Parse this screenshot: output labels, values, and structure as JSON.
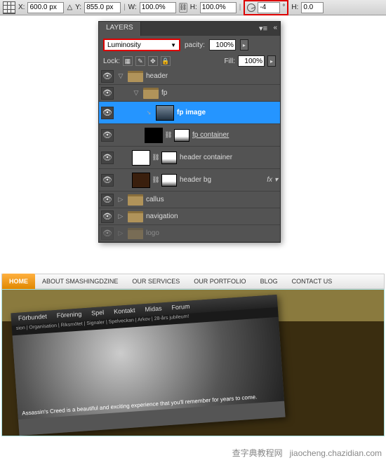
{
  "options": {
    "x_lbl": "X:",
    "x": "600.0 px",
    "y_lbl": "Y:",
    "y": "855.0 px",
    "delta_lbl": "△",
    "w_lbl": "W:",
    "w": "100.0%",
    "h_lbl": "H:",
    "h": "100.0%",
    "angle": "-4",
    "angle_unit": "°",
    "h2_lbl": "H:",
    "h2": "0.0"
  },
  "panel": {
    "tab": "LAYERS",
    "blend_mode": "Luminosity",
    "opacity_lbl": "pacity:",
    "opacity_val": "100%",
    "lock_lbl": "Lock:",
    "fill_lbl": "Fill:",
    "fill_val": "100%",
    "fx_lbl": "fx",
    "layers": [
      {
        "name": "header",
        "type": "group",
        "open": true,
        "indent": 0
      },
      {
        "name": "fp",
        "type": "group",
        "open": true,
        "indent": 1
      },
      {
        "name": "fp image",
        "type": "layer",
        "sel": true,
        "indent": 2,
        "thumb": "img"
      },
      {
        "name": "fp container",
        "type": "layer",
        "indent": 2,
        "thumb": "blk",
        "mask": true
      },
      {
        "name": "header container",
        "type": "layer",
        "indent": 1,
        "thumb": "wht",
        "mask": true
      },
      {
        "name": "header bg",
        "type": "layer",
        "indent": 1,
        "thumb": "brn",
        "mask": true,
        "fx": true
      },
      {
        "name": "callus",
        "type": "group",
        "open": false,
        "indent": 0
      },
      {
        "name": "navigation",
        "type": "group",
        "open": false,
        "indent": 0
      },
      {
        "name": "logo",
        "type": "group",
        "open": false,
        "indent": 0,
        "faded": true
      }
    ]
  },
  "mockup": {
    "nav": [
      "HOME",
      "ABOUT SMASHINGDZINE",
      "OUR SERVICES",
      "OUR PORTFOLIO",
      "BLOG",
      "CONTACT US"
    ],
    "warp_nav": [
      "Förbundet",
      "Förening",
      "Spel",
      "Kontakt",
      "Midas",
      "Forum"
    ],
    "warp_sub": "sion | Organisation | Riksmötet | Signaler | Spelveckan | Arkov | 28-års jubileum!",
    "warp_caption": "Assassin's Creed is a beautiful and exciting experience that you'll remember for years to come."
  },
  "watermark": {
    "zh": "查字典教程网",
    "url": "jiaocheng.chazidian.com"
  }
}
